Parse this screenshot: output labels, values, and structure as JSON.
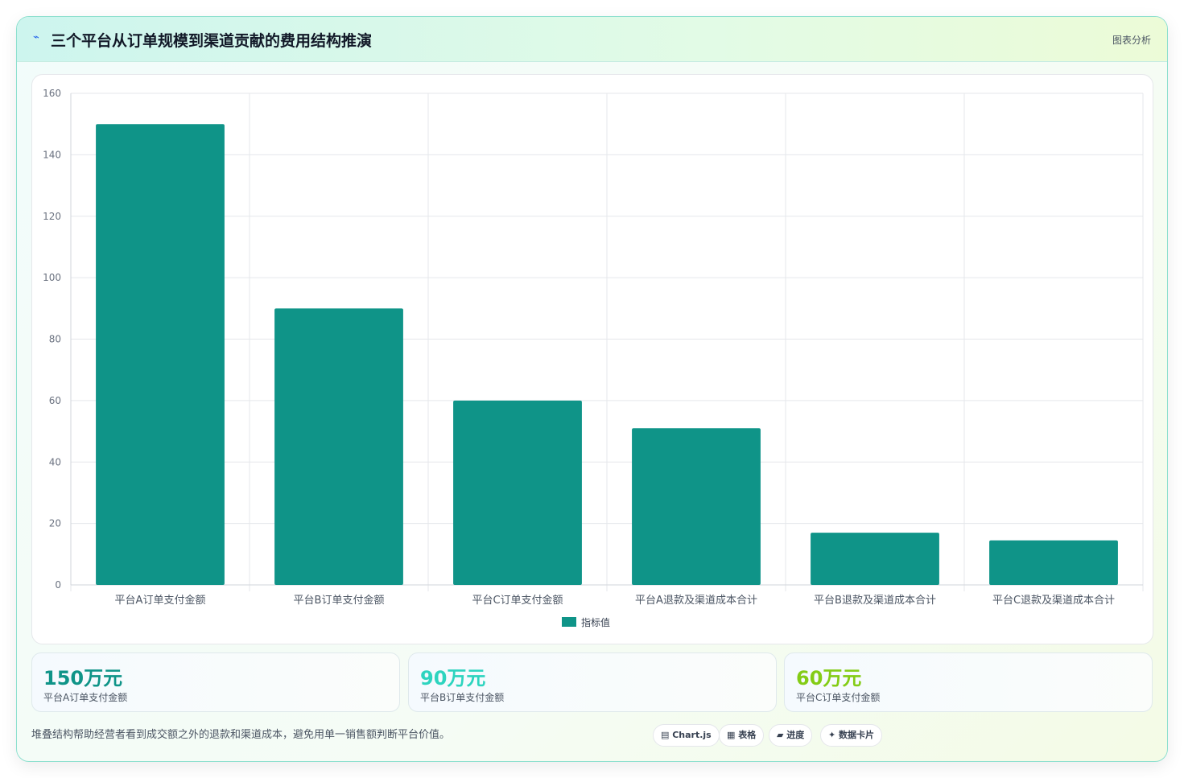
{
  "header": {
    "icon": "chart-line-icon",
    "title": "三个平台从订单规模到渠道贡献的费用结构推演",
    "tag": "图表分析"
  },
  "chart_data": {
    "type": "bar",
    "categories": [
      "平台A订单支付金额",
      "平台B订单支付金额",
      "平台C订单支付金额",
      "平台A退款及渠道成本合计",
      "平台B退款及渠道成本合计",
      "平台C退款及渠道成本合计"
    ],
    "series": [
      {
        "name": "指标值",
        "values": [
          150,
          90,
          60,
          51,
          17,
          14.5
        ],
        "color": "#0f9488"
      }
    ],
    "ylim": [
      0,
      160
    ],
    "yticks": [
      0,
      20,
      40,
      60,
      80,
      100,
      120,
      140,
      160
    ],
    "grid": true,
    "legend": "bottom"
  },
  "stats": [
    {
      "value": "150万元",
      "label": "平台A订单支付金额",
      "color": "#0f9488"
    },
    {
      "value": "90万元",
      "label": "平台B订单支付金额",
      "color": "#2dd4bf"
    },
    {
      "value": "60万元",
      "label": "平台C订单支付金额",
      "color": "#84cc16"
    }
  ],
  "footer": {
    "note": "堆叠结构帮助经营者看到成交额之外的退款和渠道成本，避免用单一销售额判断平台价值。",
    "pills": [
      {
        "icon": "chart-icon",
        "label": "▤ Chart.js"
      },
      {
        "icon": "table-icon",
        "label": "▦ 表格"
      },
      {
        "icon": "progress-icon",
        "label": "▰ 进度"
      },
      {
        "icon": "card-icon",
        "label": "✦ 数据卡片"
      }
    ]
  }
}
